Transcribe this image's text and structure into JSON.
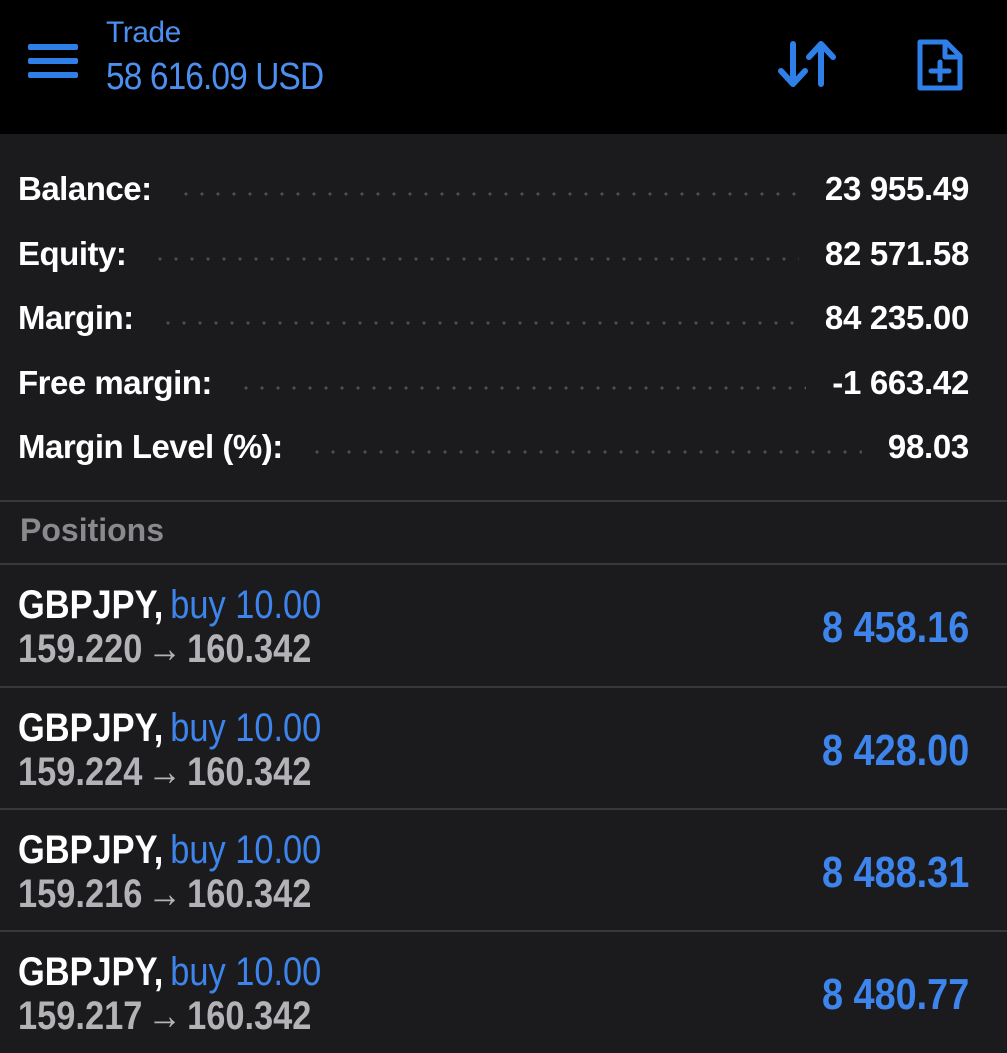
{
  "header": {
    "title": "Trade",
    "subtitle": "58 616.09 USD",
    "icons": {
      "menu": "hamburger-menu-icon",
      "sort": "sort-arrows-icon",
      "new_order": "new-order-document-icon"
    }
  },
  "summary": {
    "rows": [
      {
        "label": "Balance:",
        "value": "23 955.49"
      },
      {
        "label": "Equity:",
        "value": "82 571.58"
      },
      {
        "label": "Margin:",
        "value": "84 235.00"
      },
      {
        "label": "Free margin:",
        "value": "-1 663.42"
      },
      {
        "label": "Margin Level (%):",
        "value": "98.03"
      }
    ]
  },
  "positions": {
    "header": "Positions",
    "items": [
      {
        "symbol": "GBPJPY",
        "direction": "buy 10.00",
        "open_price": "159.220",
        "arrow": "→",
        "current_price": "160.342",
        "profit": "8 458.16"
      },
      {
        "symbol": "GBPJPY",
        "direction": "buy 10.00",
        "open_price": "159.224",
        "arrow": "→",
        "current_price": "160.342",
        "profit": "8 428.00"
      },
      {
        "symbol": "GBPJPY",
        "direction": "buy 10.00",
        "open_price": "159.216",
        "arrow": "→",
        "current_price": "160.342",
        "profit": "8 488.31"
      },
      {
        "symbol": "GBPJPY",
        "direction": "buy 10.00",
        "open_price": "159.217",
        "arrow": "→",
        "current_price": "160.342",
        "profit": "8 480.77"
      }
    ]
  },
  "colors": {
    "accent": "#3d85ec",
    "background": "#1b1b1d",
    "topbar": "#000000",
    "text_primary": "#ffffff",
    "text_secondary": "#b3b3b7",
    "section_title": "#8a8a8e"
  }
}
